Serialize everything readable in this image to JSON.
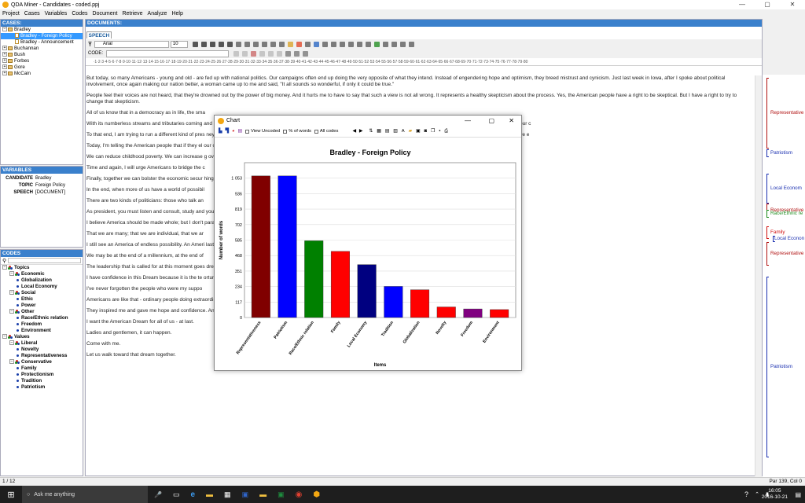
{
  "window": {
    "title": "QDA Miner - Candidates - coded.ppj",
    "min": "—",
    "max": "▢",
    "close": "✕"
  },
  "menu": [
    "Project",
    "Cases",
    "Variables",
    "Codes",
    "Document",
    "Retrieve",
    "Analyze",
    "Help"
  ],
  "cases": {
    "header": "CASES:",
    "items": [
      {
        "label": "Bradley",
        "level": 0,
        "expanded": true
      },
      {
        "label": "Bradley - Foreign Policy",
        "level": 1,
        "selected": true
      },
      {
        "label": "Bradley - Announcement",
        "level": 1
      },
      {
        "label": "Buchannan",
        "level": 0
      },
      {
        "label": "Bush",
        "level": 0
      },
      {
        "label": "Forbes",
        "level": 0
      },
      {
        "label": "Gore",
        "level": 0
      },
      {
        "label": "McCain",
        "level": 0
      }
    ]
  },
  "variables": {
    "header": "VARIABLES",
    "rows": [
      {
        "key": "CANDIDATE",
        "value": "Bradley"
      },
      {
        "key": "TOPIC",
        "value": "Foreign Policy"
      },
      {
        "key": "SPEECH",
        "value": "[DOCUMENT]"
      }
    ]
  },
  "codes": {
    "header": "CODES",
    "items": [
      {
        "label": "Topics",
        "level": 0,
        "kind": "group"
      },
      {
        "label": "Economic",
        "level": 1,
        "kind": "group"
      },
      {
        "label": "Globalization",
        "level": 2,
        "kind": "code"
      },
      {
        "label": "Local Economy",
        "level": 2,
        "kind": "code"
      },
      {
        "label": "Social",
        "level": 1,
        "kind": "group"
      },
      {
        "label": "Ethic",
        "level": 2,
        "kind": "code"
      },
      {
        "label": "Power",
        "level": 2,
        "kind": "code"
      },
      {
        "label": "Other",
        "level": 1,
        "kind": "group"
      },
      {
        "label": "Race/Ethnic relation",
        "level": 2,
        "kind": "code"
      },
      {
        "label": "Freedom",
        "level": 2,
        "kind": "code"
      },
      {
        "label": "Environment",
        "level": 2,
        "kind": "code"
      },
      {
        "label": "Values",
        "level": 0,
        "kind": "group"
      },
      {
        "label": "Liberal",
        "level": 1,
        "kind": "group"
      },
      {
        "label": "Novelty",
        "level": 2,
        "kind": "code"
      },
      {
        "label": "Representativeness",
        "level": 2,
        "kind": "code"
      },
      {
        "label": "Conservative",
        "level": 1,
        "kind": "group"
      },
      {
        "label": "Family",
        "level": 2,
        "kind": "code"
      },
      {
        "label": "Protectionism",
        "level": 2,
        "kind": "code"
      },
      {
        "label": "Tradition",
        "level": 2,
        "kind": "code"
      },
      {
        "label": "Patriotism",
        "level": 2,
        "kind": "code"
      }
    ]
  },
  "documents": {
    "header": "DOCUMENTS:",
    "tab": "SPEECH",
    "font": "Arial",
    "font_size": "10",
    "code_label": "CODE:",
    "paragraphs": [
      "But today, so many Americans - young and old - are fed up with national politics. Our campaigns often end up doing the very opposite of what they intend. Instead of engendering hope and optimism, they breed mistrust and cynicism. Just last week in Iowa, after I spoke about political involvement, once again making our nation better, a woman came up to me and said, \"It all sounds so wonderful, if only it could be true.\"",
      "People feel their voices are not heard, that they're drowned out by the power of big money. And it hurts me to have to say that such a view is not all wrong. It represents a healthy skepticism about the process. Yes, the American people have a right to be skeptical. But I have a right to try to change that skepticism.",
      "All of us know that in a democracy as in life, the sma",
      "With its numberless streams and tributaries coming                                                                                                                    and unstoppable when we flow together. One of the reasons I am running for president is to restore trust in public service and confidence in our c",
      "To that end, I am trying to run a different kind of pres                                                                                                                    ney from ordinary citizens, not from special interest PACs. I'm hoping that by Election Day, we will be choosing between two people whom we e",
      "Today, I'm telling the American people that if they el                                                                                                                    our common future. I'll use the growth of the new economy and do some of the big things that need to be done in this country:",
      "We can reduce childhood poverty. We can increase                                                                                                                    g overdue gun control. If we do these things, we will be safer, healthier and more in control of our future.",
      "Time and again, I will urge Americans to bridge the c",
      "Finally, together we can bolster the economic secur                                                                                                                    hings, and we will do them more thoroughly.",
      "In the end, when more of us have a world of possibil",
      "There are two kinds of politicians: those who talk an",
      "As president, you must listen and consult, study and                                                                                                                    you are given to see the right, and then trust that the people will understand.",
      "I believe America should be made whole; but I don't                                                                                                                    paradox of America is this:",
      "That we are many; that we are individual, that we ar",
      "I still see an America of endless possibility. An Ameri                                                                                                                    last best hope of mankind.\"",
      "We may be at the end of a millennium, at the end of",
      "The leadership that is called for at this moment goes                                                                                                                    dream dreams we never thought possible before.",
      "I have confidence in this Dream because it is the te                                                                                                                    ortunity that enabled me to forge a path on my own.",
      "I've never forgotten the people who were my suppo",
      "Americans are like that - ordinary people doing extraordinary things.",
      "They inspired me and gave me hope and confidence. And I want that hope, that encouragement, that sense of possibility to be a reality for everybody.",
      "I want the American Dream for all of us - at last.",
      "Ladies and gentlemen, it can happen.",
      "Come with me.",
      "Let us walk toward that dream together."
    ]
  },
  "codebar": [
    {
      "label": "Representative",
      "color": "#b01010"
    },
    {
      "label": "Patriotism",
      "color": "#1a2fb0"
    },
    {
      "label": "Local Econom",
      "color": "#1a2fb0"
    },
    {
      "label": "Representative",
      "color": "#b01010"
    },
    {
      "label": "Race/Ethnic re",
      "color": "#1a8a1a"
    },
    {
      "label": "Family",
      "color": "#d01010"
    },
    {
      "label": "Local Econon",
      "color": "#1a2fb0"
    },
    {
      "label": "Representative",
      "color": "#b01010"
    },
    {
      "label": "Patriotism",
      "color": "#1a2fb0"
    }
  ],
  "status": {
    "left": "1 / 12",
    "right": "Par 139, Col 0"
  },
  "taskbar": {
    "search": "Ask me anything",
    "time": "16:05",
    "date": "2016-10-21"
  },
  "chart_window": {
    "title": "Chart",
    "options": [
      "View Uncoded",
      "% of words",
      "All codes"
    ]
  },
  "chart_data": {
    "type": "bar",
    "title": "Bradley - Foreign Policy",
    "xlabel": "Items",
    "ylabel": "Number of words",
    "yticks": [
      "0",
      "117",
      "234",
      "351",
      "468",
      "585",
      "702",
      "819",
      "936",
      "1 053"
    ],
    "ylim": [
      0,
      1170
    ],
    "categories": [
      "Representativeness",
      "Patriotism",
      "Race/Ethnic relation",
      "Family",
      "Local Economy",
      "Tradition",
      "Globalization",
      "Novelty",
      "Freedom",
      "Environment"
    ],
    "values": [
      1070,
      1070,
      580,
      500,
      400,
      235,
      210,
      80,
      65,
      60
    ],
    "colors": [
      "#800000",
      "#0000ff",
      "#008000",
      "#ff0000",
      "#000080",
      "#0000ff",
      "#ff0000",
      "#ff0000",
      "#800080",
      "#ff0000"
    ]
  }
}
